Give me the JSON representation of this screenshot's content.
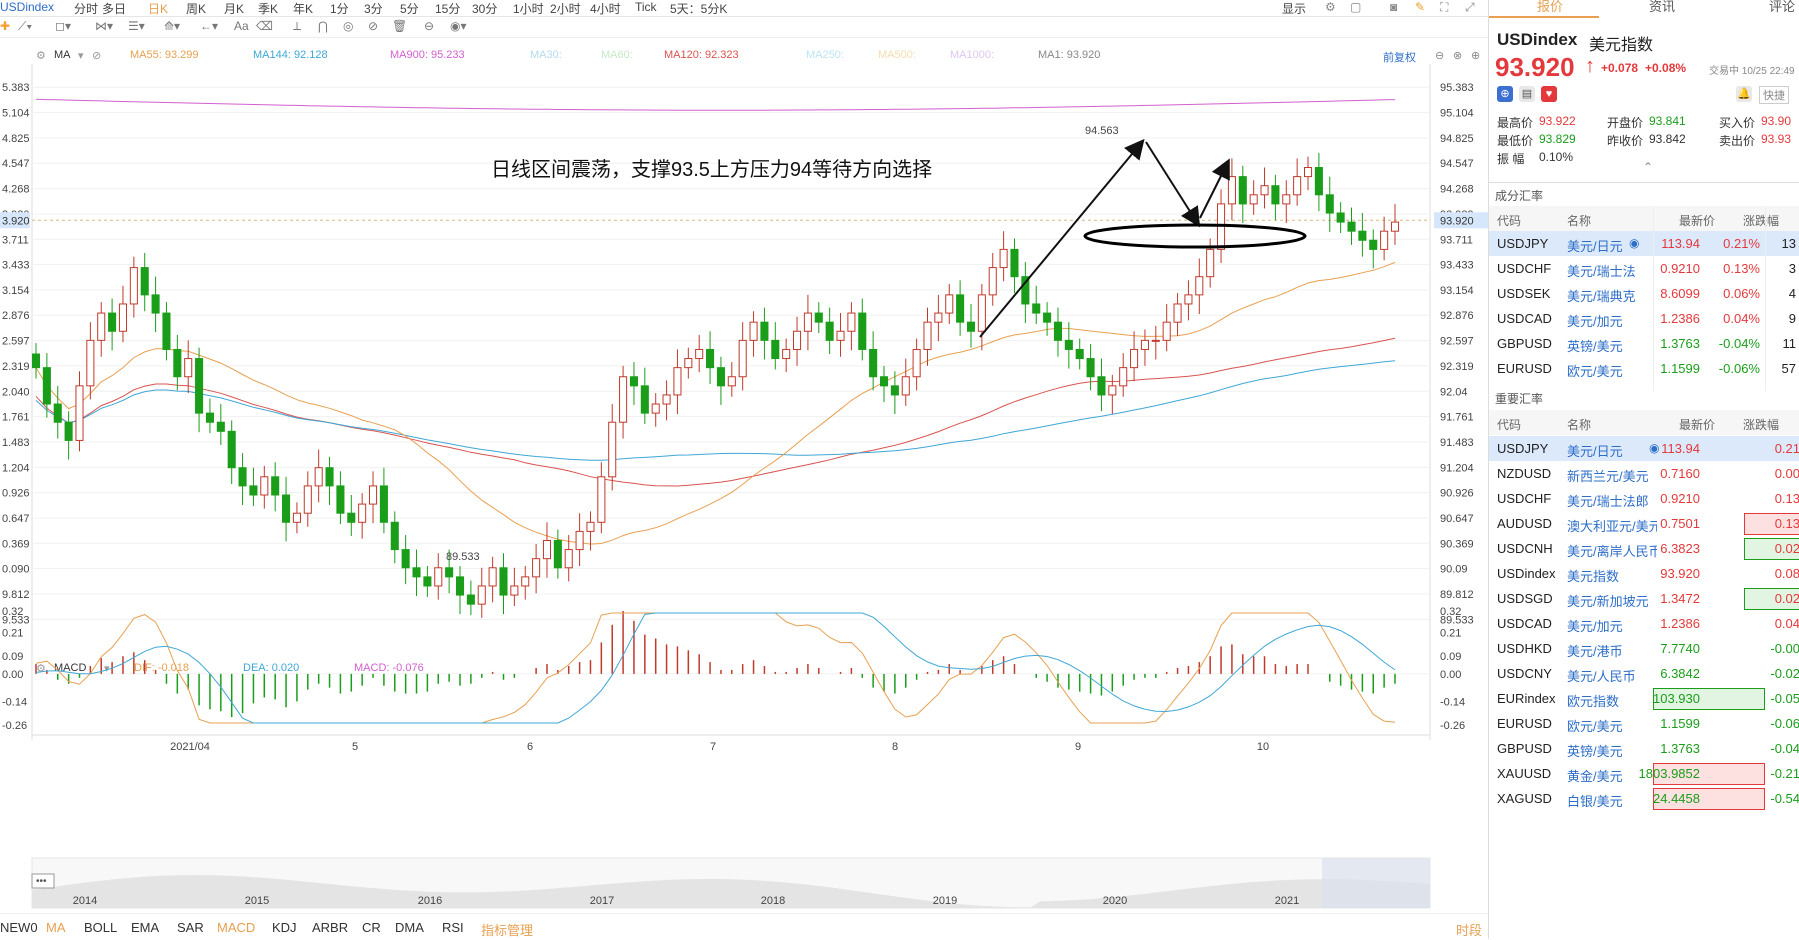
{
  "topbar": {
    "symbol": "USDindex",
    "periods": [
      "分时",
      "多日",
      "日K",
      "周K",
      "月K",
      "季K",
      "年K",
      "1分",
      "3分",
      "5分",
      "15分",
      "30分",
      "1小时",
      "2小时",
      "4小时",
      "Tick",
      "5天：5分K"
    ],
    "active_period": "日K",
    "display_label": "显示",
    "right_tabs": [
      "报价",
      "资讯",
      "评论"
    ]
  },
  "toolbar": {
    "text_tool": "Aa"
  },
  "ma_bar": {
    "label": "MA",
    "items": [
      {
        "text": "MA55: 93.299",
        "color": "#e8a050"
      },
      {
        "text": "MA144: 92.128",
        "color": "#3fa7d6"
      },
      {
        "text": "MA900: 95.233",
        "color": "#d35fd0"
      },
      {
        "text": "MA30:",
        "color": "#b8d8f0"
      },
      {
        "text": "MA60:",
        "color": "#c8e8c8"
      },
      {
        "text": "MA120: 92.323",
        "color": "#d9534f"
      },
      {
        "text": "MA250:",
        "color": "#bde4f4"
      },
      {
        "text": "MA500:",
        "color": "#f5ddb0"
      },
      {
        "text": "MA1000:",
        "color": "#e0c8f0"
      },
      {
        "text": "MA1: 93.920",
        "color": "#888888"
      }
    ],
    "adjust": "前复权"
  },
  "macd_bar": {
    "label": "MACD",
    "items": [
      {
        "text": "DIF: -0.018",
        "color": "#e8a050"
      },
      {
        "text": "DEA: 0.020",
        "color": "#3fa7d6"
      },
      {
        "text": "MACD: -0.076",
        "color": "#d35fd0"
      }
    ]
  },
  "annotation": "日线区间震荡，支撑93.5上方压力94等待方向选择",
  "chart_data": {
    "type": "candlestick",
    "title": "",
    "price_ticks": [
      95.383,
      95.104,
      94.825,
      94.547,
      94.268,
      93.989,
      93.711,
      93.433,
      93.154,
      92.876,
      92.597,
      92.319,
      92.04,
      91.761,
      91.483,
      91.204,
      90.926,
      90.647,
      90.369,
      90.09,
      89.812,
      89.533
    ],
    "price_ticks_left": [
      "5.383",
      "5.104",
      "4.825",
      "4.547",
      "4.268",
      "3.920",
      "3.711",
      "3.433",
      "3.154",
      "2.876",
      "2.597",
      "2.319",
      "2.040",
      "1.761",
      "1.483",
      "1.204",
      "0.926",
      "0.647",
      "0.369",
      "0.090",
      "9.812",
      "9.533"
    ],
    "current_price": 93.92,
    "current_label_right": "93.920",
    "high_label": "94.563",
    "low_label": "89.533",
    "ylim": [
      89.35,
      95.55
    ],
    "x_labels": [
      "2021/04",
      "5",
      "6",
      "7",
      "8",
      "9",
      "10"
    ],
    "macd_ticks": [
      0.32,
      0.21,
      0.09,
      0.0,
      -0.14,
      -0.26
    ],
    "macd_tick_labels": [
      "0.32",
      "0.21",
      "0.09",
      "0.00",
      "-0.14",
      "-0.26"
    ],
    "overview_years": [
      "2014",
      "2015",
      "2016",
      "2017",
      "2018",
      "2019",
      "2020",
      "2021"
    ],
    "closes": [
      92.3,
      91.9,
      91.7,
      91.5,
      92.1,
      92.6,
      92.9,
      92.7,
      93.0,
      93.4,
      93.1,
      92.9,
      92.5,
      92.2,
      92.4,
      91.8,
      91.7,
      91.6,
      91.2,
      91.0,
      90.9,
      91.1,
      90.9,
      90.6,
      90.7,
      91.0,
      91.2,
      91.0,
      90.7,
      90.6,
      90.8,
      91.0,
      90.6,
      90.3,
      90.1,
      90.0,
      89.9,
      90.1,
      90.0,
      89.8,
      89.7,
      89.9,
      90.1,
      89.8,
      89.9,
      90.0,
      90.2,
      90.4,
      90.1,
      90.3,
      90.5,
      90.6,
      91.1,
      91.7,
      92.2,
      92.1,
      91.8,
      91.9,
      92.0,
      92.3,
      92.4,
      92.5,
      92.3,
      92.1,
      92.2,
      92.6,
      92.8,
      92.6,
      92.4,
      92.5,
      92.7,
      92.9,
      92.8,
      92.6,
      92.7,
      92.9,
      92.5,
      92.2,
      92.1,
      92.0,
      92.2,
      92.5,
      92.8,
      92.9,
      93.1,
      92.8,
      92.7,
      93.1,
      93.4,
      93.6,
      93.3,
      93.0,
      92.9,
      92.8,
      92.6,
      92.5,
      92.4,
      92.2,
      92.0,
      92.1,
      92.3,
      92.5,
      92.6,
      92.6,
      92.8,
      93.0,
      93.1,
      93.3,
      93.6,
      94.1,
      94.4,
      94.1,
      94.2,
      94.3,
      94.1,
      94.2,
      94.4,
      94.5,
      94.2,
      94.0,
      93.9,
      93.8,
      93.7,
      93.6,
      93.8,
      93.9
    ],
    "macd_hist": [
      0.05,
      0.02,
      -0.03,
      -0.05,
      -0.02,
      0.04,
      0.08,
      0.06,
      0.09,
      0.11,
      0.07,
      0.02,
      -0.05,
      -0.1,
      -0.08,
      -0.16,
      -0.18,
      -0.19,
      -0.22,
      -0.2,
      -0.15,
      -0.12,
      -0.13,
      -0.17,
      -0.14,
      -0.08,
      -0.05,
      -0.07,
      -0.1,
      -0.09,
      -0.06,
      -0.02,
      -0.06,
      -0.09,
      -0.1,
      -0.1,
      -0.09,
      -0.05,
      -0.04,
      -0.06,
      -0.05,
      -0.02,
      0.01,
      -0.03,
      -0.02,
      0.0,
      0.03,
      0.05,
      0.02,
      0.04,
      0.06,
      0.07,
      0.16,
      0.25,
      0.32,
      0.27,
      0.2,
      0.18,
      0.15,
      0.14,
      0.12,
      0.1,
      0.06,
      0.02,
      0.02,
      0.05,
      0.07,
      0.04,
      0.01,
      0.01,
      0.03,
      0.05,
      0.03,
      0.0,
      0.01,
      0.03,
      -0.02,
      -0.07,
      -0.09,
      -0.1,
      -0.07,
      -0.03,
      0.01,
      0.02,
      0.05,
      0.02,
      0.0,
      0.04,
      0.07,
      0.09,
      0.05,
      0.0,
      -0.02,
      -0.04,
      -0.07,
      -0.08,
      -0.09,
      -0.1,
      -0.11,
      -0.09,
      -0.06,
      -0.03,
      -0.02,
      -0.02,
      0.01,
      0.03,
      0.04,
      0.06,
      0.09,
      0.14,
      0.15,
      0.1,
      0.09,
      0.09,
      0.05,
      0.04,
      0.05,
      0.05,
      0.0,
      -0.04,
      -0.06,
      -0.08,
      -0.09,
      -0.1,
      -0.07,
      -0.05
    ]
  },
  "panel": {
    "symbol": "USDindex",
    "name": "美元指数",
    "price": "93.920",
    "change": "+0.078",
    "change_pct": "+0.08%",
    "status": "交易中 10/25 22:49",
    "quick": "快捷",
    "stats": [
      {
        "label": "最高价",
        "value": "93.922",
        "cls": "red"
      },
      {
        "label": "开盘价",
        "value": "93.841",
        "cls": "grn"
      },
      {
        "label": "买入价",
        "value": "93.90",
        "cls": "red"
      },
      {
        "label": "最低价",
        "value": "93.829",
        "cls": "grn"
      },
      {
        "label": "昨收价",
        "value": "93.842",
        "cls": ""
      },
      {
        "label": "卖出价",
        "value": "93.93",
        "cls": "red"
      }
    ],
    "amplitude_label": "振  幅",
    "amplitude": "0.10%",
    "section1": "成分汇率",
    "section2": "重要汇率",
    "headers": [
      "代码",
      "名称",
      "最新价",
      "涨跌幅"
    ],
    "components": [
      {
        "code": "USDJPY",
        "name": "美元/日元",
        "price": "113.94",
        "pct": "0.21%",
        "extra": "13",
        "up": true,
        "hl": true
      },
      {
        "code": "USDCHF",
        "name": "美元/瑞士法",
        "price": "0.9210",
        "pct": "0.13%",
        "extra": "3",
        "up": true
      },
      {
        "code": "USDSEK",
        "name": "美元/瑞典克",
        "price": "8.6099",
        "pct": "0.06%",
        "extra": "4",
        "up": true
      },
      {
        "code": "USDCAD",
        "name": "美元/加元",
        "price": "1.2386",
        "pct": "0.04%",
        "extra": "9",
        "up": true
      },
      {
        "code": "GBPUSD",
        "name": "英镑/美元",
        "price": "1.3763",
        "pct": "-0.04%",
        "extra": "11",
        "up": false
      },
      {
        "code": "EURUSD",
        "name": "欧元/美元",
        "price": "1.1599",
        "pct": "-0.06%",
        "extra": "57",
        "up": false
      }
    ],
    "important": [
      {
        "code": "USDJPY",
        "name": "美元/日元",
        "price": "113.94",
        "pct": "0.21",
        "up": true,
        "hl": true
      },
      {
        "code": "NZDUSD",
        "name": "新西兰元/美元",
        "price": "0.7160",
        "pct": "0.00",
        "up": true
      },
      {
        "code": "USDCHF",
        "name": "美元/瑞士法郎",
        "price": "0.9210",
        "pct": "0.13",
        "up": true
      },
      {
        "code": "AUDUSD",
        "name": "澳大利亚元/美元",
        "price": "0.7501",
        "pct": "0.13",
        "up": true,
        "box": "r2"
      },
      {
        "code": "USDCNH",
        "name": "美元/离岸人民币",
        "price": "6.3823",
        "pct": "0.02",
        "up": true,
        "box": "g2"
      },
      {
        "code": "USDindex",
        "name": "美元指数",
        "price": "93.920",
        "pct": "0.08",
        "up": true
      },
      {
        "code": "USDSGD",
        "name": "美元/新加坡元",
        "price": "1.3472",
        "pct": "0.02",
        "up": true,
        "box": "g2"
      },
      {
        "code": "USDCAD",
        "name": "美元/加元",
        "price": "1.2386",
        "pct": "0.04",
        "up": true
      },
      {
        "code": "USDHKD",
        "name": "美元/港币",
        "price": "7.7740",
        "pct": "-0.00",
        "up": false
      },
      {
        "code": "USDCNY",
        "name": "美元/人民币",
        "price": "6.3842",
        "pct": "-0.02",
        "up": false
      },
      {
        "code": "EURindex",
        "name": "欧元指数",
        "price": "103.930",
        "pct": "-0.05",
        "up": false,
        "box": "g1"
      },
      {
        "code": "EURUSD",
        "name": "欧元/美元",
        "price": "1.1599",
        "pct": "-0.06",
        "up": false
      },
      {
        "code": "GBPUSD",
        "name": "英镑/美元",
        "price": "1.3763",
        "pct": "-0.04",
        "up": false
      },
      {
        "code": "XAUUSD",
        "name": "黄金/美元",
        "price": "1803.9852",
        "pct": "-0.21",
        "up": false,
        "box": "r1"
      },
      {
        "code": "XAGUSD",
        "name": "白银/美元",
        "price": "24.4458",
        "pct": "-0.54",
        "up": false,
        "box": "r1"
      }
    ]
  },
  "indicators": {
    "items": [
      "NEW0",
      "MA",
      "BOLL",
      "EMA",
      "SAR",
      "MACD",
      "KDJ",
      "ARBR",
      "CR",
      "DMA",
      "RSI",
      "指标管理"
    ],
    "active": [
      "MA",
      "MACD"
    ],
    "right": "时段"
  }
}
